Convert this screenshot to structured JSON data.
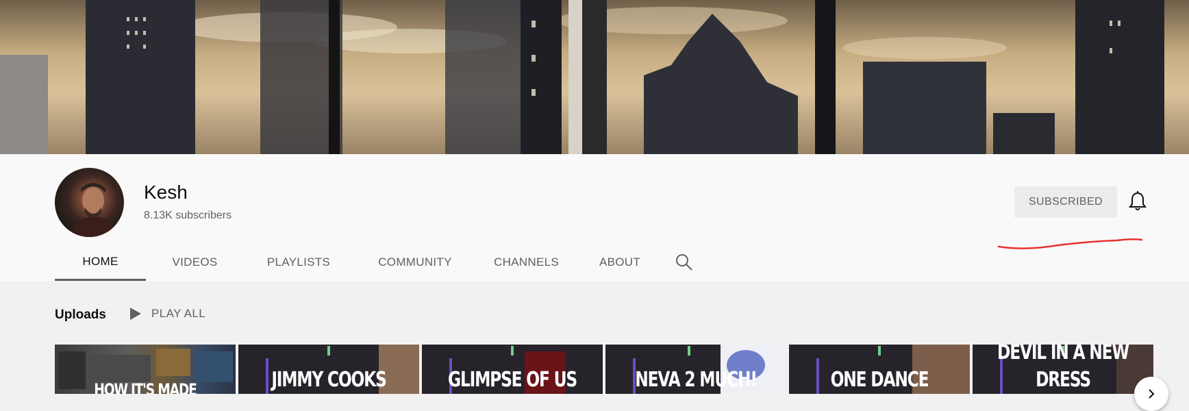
{
  "channel": {
    "name": "Kesh",
    "subscribers": "8.13K subscribers",
    "subscribe_label": "SUBSCRIBED"
  },
  "tabs": [
    {
      "label": "HOME",
      "active": true
    },
    {
      "label": "VIDEOS",
      "active": false
    },
    {
      "label": "PLAYLISTS",
      "active": false
    },
    {
      "label": "COMMUNITY",
      "active": false
    },
    {
      "label": "CHANNELS",
      "active": false
    },
    {
      "label": "ABOUT",
      "active": false
    }
  ],
  "uploads": {
    "title": "Uploads",
    "play_all_label": "PLAY ALL",
    "videos": [
      {
        "title": "HOW IT'S MADE"
      },
      {
        "title": "JIMMY COOKS"
      },
      {
        "title": "GLIMPSE OF US"
      },
      {
        "title": "NEVA 2 MUCH!"
      },
      {
        "title": "ONE DANCE"
      },
      {
        "title": "DEVIL IN A NEW DRESS"
      }
    ]
  },
  "icons": {
    "bell": "bell-icon",
    "search": "search-icon",
    "play": "play-icon",
    "next": "chevron-right-icon"
  },
  "colors": {
    "accent_underline": "#606060",
    "annotation_red": "#e5322d"
  }
}
